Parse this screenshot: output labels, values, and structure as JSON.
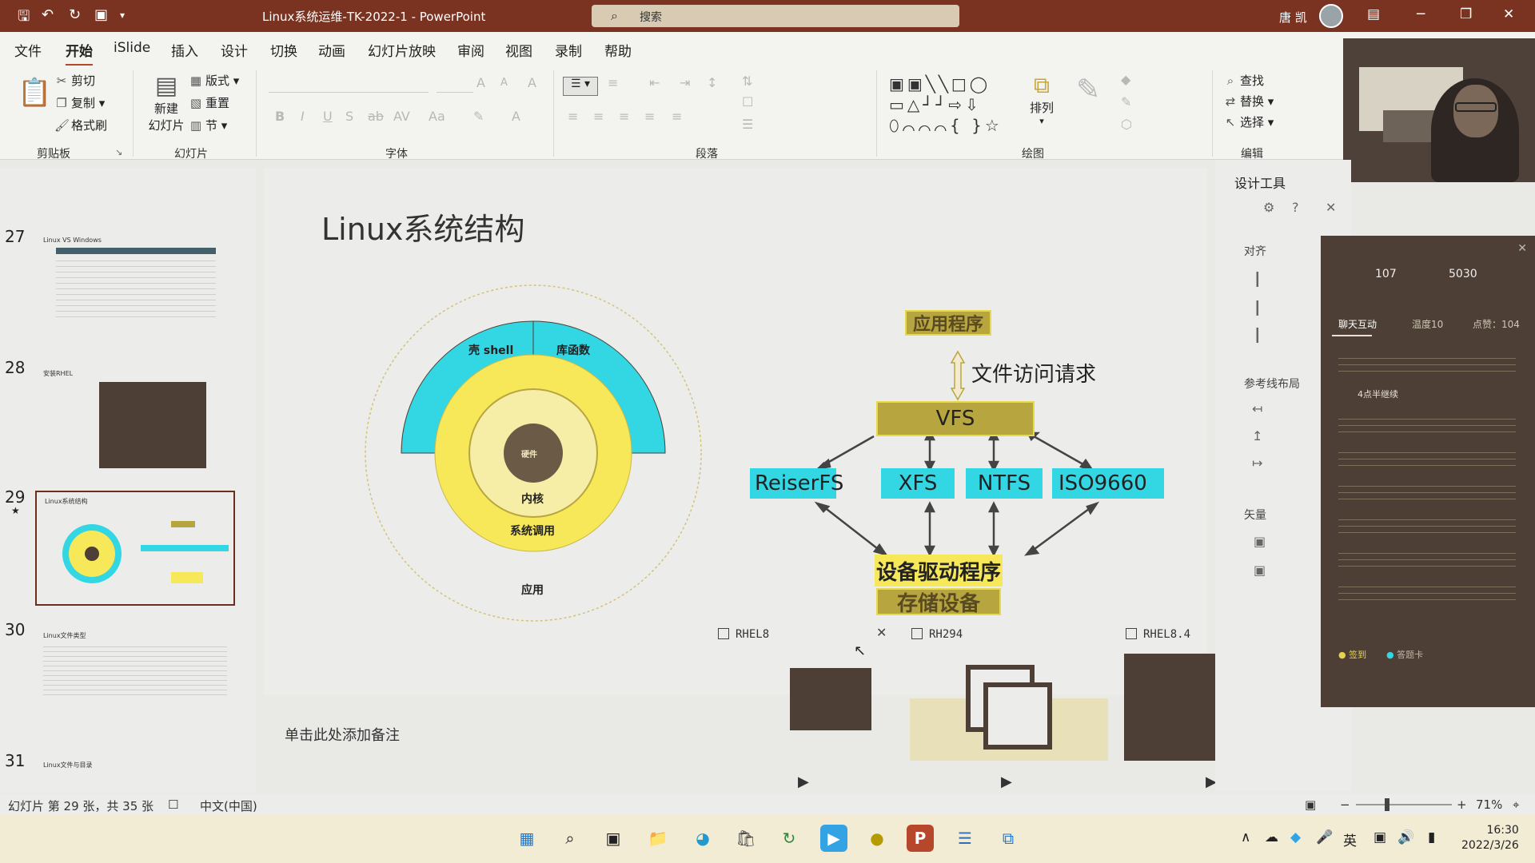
{
  "titlebar": {
    "doc_title": "Linux系统运维-TK-2022-1 - PowerPoint",
    "search_placeholder": "搜索",
    "user_name": "唐 凯"
  },
  "menu": {
    "tabs": [
      "文件",
      "开始",
      "iSlide",
      "插入",
      "设计",
      "切换",
      "动画",
      "幻灯片放映",
      "审阅",
      "视图",
      "录制",
      "帮助"
    ]
  },
  "ribbon": {
    "clipboard": {
      "cut": "剪切",
      "copy": "复制",
      "format_painter": "格式刷",
      "group": "剪贴板"
    },
    "slides": {
      "new_slide_line1": "新建",
      "new_slide_line2": "幻灯片",
      "layout": "版式",
      "reset": "重置",
      "section": "节",
      "group": "幻灯片"
    },
    "font_group": "字体",
    "paragraph_group": "段落",
    "drawing": {
      "arrange": "排列",
      "group": "绘图"
    },
    "editing": {
      "find": "查找",
      "replace": "替换",
      "select": "选择",
      "group": "编辑"
    }
  },
  "thumbnails": [
    {
      "num": "27",
      "title": "Linux VS Windows"
    },
    {
      "num": "28",
      "title": "安装RHEL"
    },
    {
      "num": "29",
      "title": "Linux系统结构",
      "selected": true
    },
    {
      "num": "30",
      "title": "Linux文件类型"
    },
    {
      "num": "31",
      "title": "Linux文件与目录"
    }
  ],
  "slide": {
    "title": "Linux系统结构",
    "rings": {
      "shell": "壳 shell",
      "library": "库函数",
      "hardware": "硬件",
      "kernel": "内核",
      "syscall": "系统调用",
      "app": "应用"
    },
    "flow": {
      "app_program": "应用程序",
      "file_request": "文件访问请求",
      "vfs": "VFS",
      "fs": [
        "ReiserFS",
        "XFS",
        "NTFS",
        "ISO9660"
      ],
      "driver": "设备驱动程序",
      "storage": "存储设备"
    }
  },
  "notes": {
    "placeholder": "单击此处添加备注"
  },
  "design_panel": {
    "title": "设计工具",
    "align": "对齐",
    "guides": "参考线布局",
    "vector": "矢量"
  },
  "chat": {
    "count_left": "107",
    "count_right": "5030",
    "tabs": [
      "聊天互动",
      "温度10",
      "点赞：104"
    ],
    "pinned": "4点半继续",
    "bottom_left": "签到",
    "bottom_right": "答题卡"
  },
  "video_tiles": [
    "RHEL8",
    "RH294",
    "RHEL8.4"
  ],
  "status": {
    "slide_info": "幻灯片 第 29 张，共 35 张",
    "language": "中文(中国)",
    "zoom": "71%"
  },
  "taskbar": {
    "ime": "英",
    "time": "16:30",
    "date": "2022/3/26"
  },
  "colors": {
    "titlebar": "#7a3320",
    "cyan": "#33d6e3",
    "yellow": "#f7e85a",
    "gold": "#b7a63f",
    "dark": "#4d3f35"
  }
}
